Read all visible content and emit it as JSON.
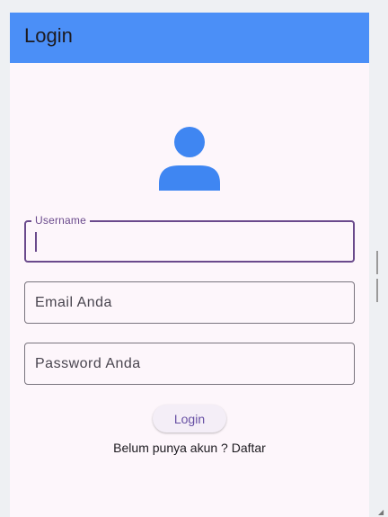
{
  "appbar": {
    "title": "Login",
    "color": "#4b8ff7"
  },
  "avatar": {
    "icon": "person-icon",
    "color": "#3f86f2"
  },
  "form": {
    "username": {
      "label": "Username",
      "value": "",
      "focused": true
    },
    "email": {
      "placeholder": "Email Anda",
      "value": ""
    },
    "password": {
      "placeholder": "Password Anda",
      "value": ""
    },
    "login_button_label": "Login",
    "register_link": "Belum punya akun ? Daftar"
  },
  "colors": {
    "background": "#fdf6fb",
    "focus": "#6a4a8c",
    "button_text": "#6750a4"
  }
}
